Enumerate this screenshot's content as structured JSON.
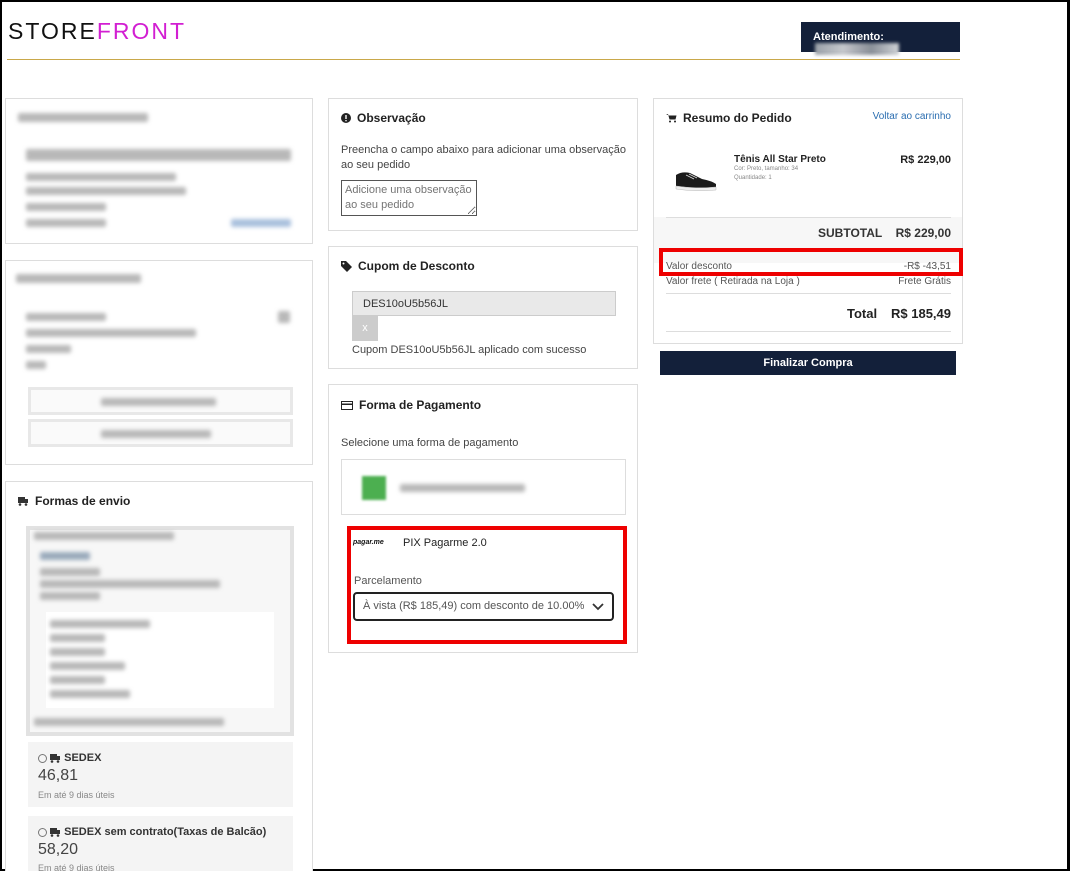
{
  "header": {
    "logo_store": "STORE",
    "logo_front": "FRONT",
    "atendimento_label": "Atendimento:"
  },
  "observacao": {
    "title": "Observação",
    "description": "Preencha o campo abaixo para adicionar uma observação ao seu pedido",
    "placeholder": "Adicione uma observação ao seu pedido"
  },
  "cupom": {
    "title": "Cupom de Desconto",
    "code": "DES10oU5b56JL",
    "remove_label": "x",
    "success_message": "Cupom DES10oU5b56JL aplicado com sucesso"
  },
  "pagamento": {
    "title": "Forma de Pagamento",
    "subtitle": "Selecione uma forma de pagamento",
    "pix_logo": "pagar.me",
    "pix_name": "PIX Pagarme 2.0",
    "parcelamento_label": "Parcelamento",
    "parcelamento_value": "À vista (R$ 185,49) com desconto de 10.00%"
  },
  "envio": {
    "title": "Formas de envio",
    "options": [
      {
        "name": "SEDEX",
        "price": "46,81",
        "eta": "Em até 9 dias úteis"
      },
      {
        "name": "SEDEX sem contrato(Taxas de Balcão)",
        "price": "58,20",
        "eta": "Em até 9 dias úteis"
      }
    ]
  },
  "resumo": {
    "title": "Resumo do Pedido",
    "back_link": "Voltar ao carrinho",
    "product": {
      "name": "Tênis All Star Preto",
      "details": "Cor: Preto, tamanho: 34",
      "quantity": "Quantidade: 1",
      "price": "R$ 229,00"
    },
    "subtotal_label": "SUBTOTAL",
    "subtotal_value": "R$ 229,00",
    "desconto_label": "Valor desconto",
    "desconto_value": "-R$ -43,51",
    "frete_label": "Valor frete ( Retirada na Loja )",
    "frete_value": "Frete Grátis",
    "total_label": "Total",
    "total_value": "R$ 185,49",
    "finalizar_label": "Finalizar Compra"
  },
  "colors": {
    "navy": "#13203a",
    "accent_magenta": "#d21fd2",
    "highlight_red": "#e00000",
    "header_rule": "#c9a84a"
  }
}
